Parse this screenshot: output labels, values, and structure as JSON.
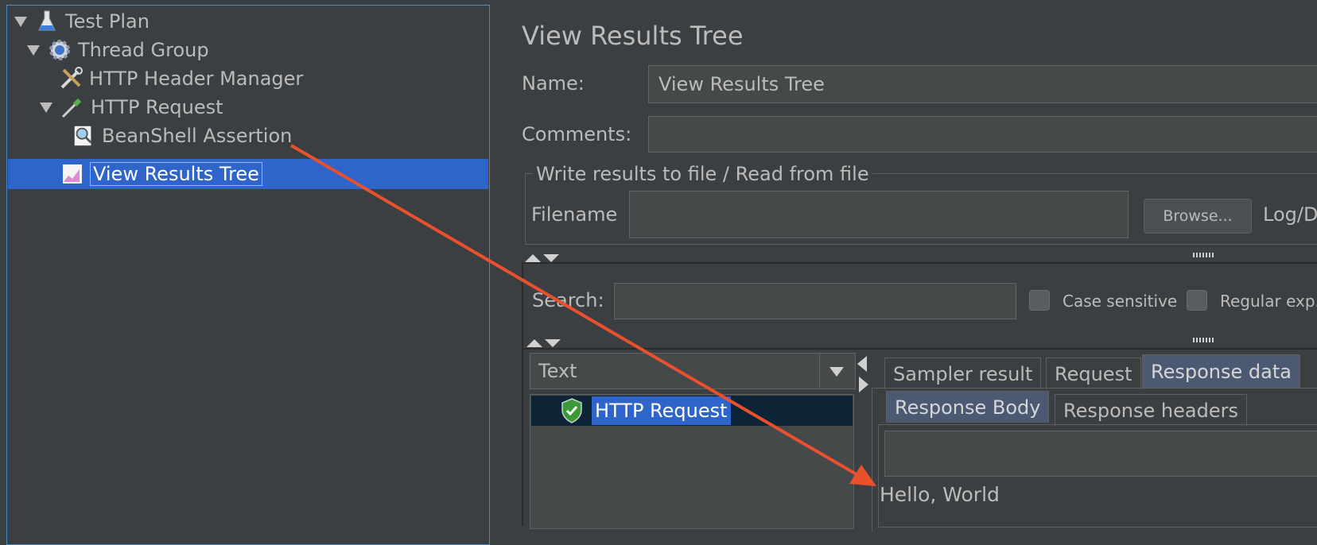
{
  "tree": {
    "items": [
      {
        "label": "Test Plan",
        "icon": "flask-icon"
      },
      {
        "label": "Thread Group",
        "icon": "gear-icon"
      },
      {
        "label": "HTTP Header Manager",
        "icon": "tools-icon"
      },
      {
        "label": "HTTP Request",
        "icon": "pipette-icon"
      },
      {
        "label": "BeanShell Assertion",
        "icon": "magnifier-icon"
      },
      {
        "label": "View Results Tree",
        "icon": "chart-icon"
      }
    ]
  },
  "panel": {
    "title": "View Results Tree",
    "name_label": "Name:",
    "name_value": "View Results Tree",
    "comments_label": "Comments:",
    "comments_value": "",
    "file_section_title": "Write results to file / Read from file",
    "filename_label": "Filename",
    "filename_value": "",
    "browse_label": "Browse...",
    "log_label": "Log/D",
    "search_label": "Search:",
    "search_value": "",
    "case_sensitive_label": "Case sensitive",
    "regex_label": "Regular exp.",
    "renderer_selected": "Text",
    "result_item": "HTTP Request",
    "tabs": [
      "Sampler result",
      "Request",
      "Response data"
    ],
    "subtabs": [
      "Response Body",
      "Response headers"
    ],
    "response_body": "Hello, World"
  },
  "colors": {
    "background": "#3c3f41",
    "selection": "#2f65ca",
    "annotation_arrow": "#e8502e",
    "success_shield": "#3a9a3a"
  }
}
